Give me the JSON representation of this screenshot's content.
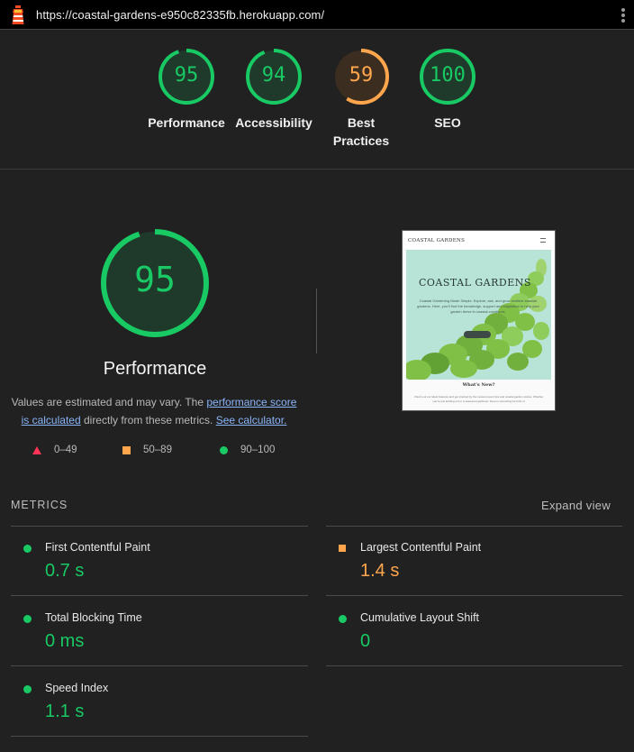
{
  "header": {
    "url": "https://coastal-gardens-e950c82335fb.herokuapp.com/"
  },
  "colors": {
    "pass": "#18c964",
    "average": "#ffa64d",
    "fail": "#ff3355",
    "link": "#8ab4f8"
  },
  "summary": [
    {
      "label": "Performance",
      "score": "95",
      "rating": "pass"
    },
    {
      "label": "Accessibility",
      "score": "94",
      "rating": "pass"
    },
    {
      "label": "Best Practices",
      "label_line1": "Best",
      "label_line2": "Practices",
      "score": "59",
      "rating": "average"
    },
    {
      "label": "SEO",
      "score": "100",
      "rating": "pass"
    }
  ],
  "performance": {
    "score": "95",
    "title": "Performance",
    "desc_prefix": "Values are estimated and may vary. The ",
    "desc_link1": "performance score",
    "desc_link1b": "is calculated",
    "desc_mid": " directly from these metrics. ",
    "desc_link2": "See calculator."
  },
  "legend": [
    {
      "range": "0–49",
      "shape": "triangle"
    },
    {
      "range": "50–89",
      "shape": "square"
    },
    {
      "range": "90–100",
      "shape": "circle"
    }
  ],
  "thumbnail": {
    "brand": "COASTAL GARDENS",
    "hero_title": "COASTAL GARDENS",
    "hero_text": "Coastal Gardening Made Simple. Explore, ask, and grow resilient seaside gardens. Here, you'll find the knowledge, support and inspiration to help your garden thrive in coastal conditions.",
    "section_title": "What's New?",
    "section_text": "Check out our latest features and get inspired by the newest expert tips and coastal garden stories. Whether you're just starting out or a seasoned gardener, there is something for both of"
  },
  "metrics": {
    "heading": "METRICS",
    "expand_label": "Expand view",
    "items": [
      {
        "name": "First Contentful Paint",
        "value": "0.7 s",
        "rating": "pass"
      },
      {
        "name": "Largest Contentful Paint",
        "value": "1.4 s",
        "rating": "average"
      },
      {
        "name": "Total Blocking Time",
        "value": "0 ms",
        "rating": "pass"
      },
      {
        "name": "Cumulative Layout Shift",
        "value": "0",
        "rating": "pass"
      },
      {
        "name": "Speed Index",
        "value": "1.1 s",
        "rating": "pass"
      }
    ]
  }
}
